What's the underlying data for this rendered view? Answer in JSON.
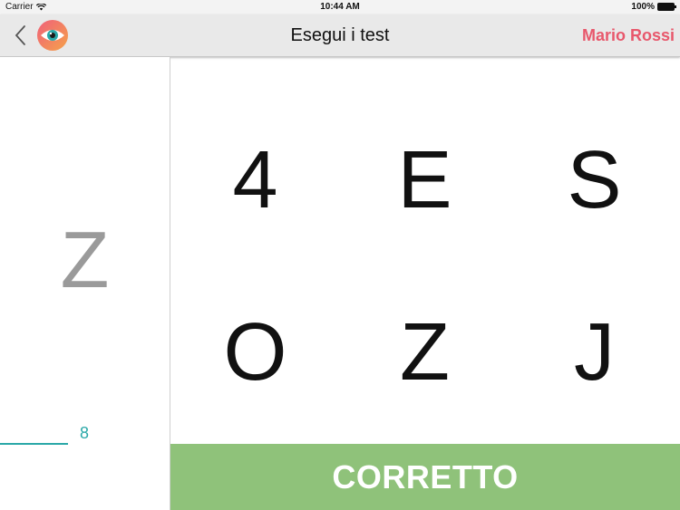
{
  "status_bar": {
    "carrier": "Carrier",
    "time": "10:44 AM",
    "battery": "100%"
  },
  "nav": {
    "title": "Esegui i test",
    "user_name": "Mario Rossi"
  },
  "test": {
    "current_letter": "Z",
    "progress_count": "8",
    "choices": [
      "4",
      "E",
      "S",
      "O",
      "Z",
      "J"
    ],
    "feedback": "CORRETTO"
  },
  "colors": {
    "accent_user": "#e8586c",
    "progress": "#2aa8a8",
    "correct_banner": "#8fc27a"
  }
}
